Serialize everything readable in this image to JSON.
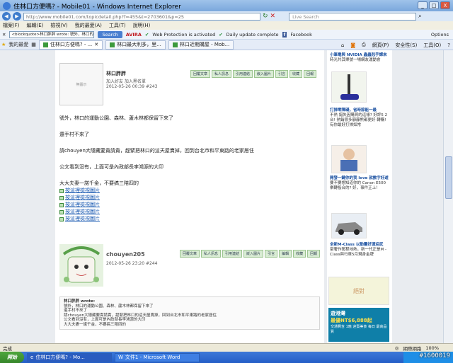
{
  "window": {
    "title": "住林口方便嗎? - Mobile01 - Windows Internet Explorer",
    "min": "_",
    "max": "□",
    "close": "X"
  },
  "address": {
    "url": "http://www.mobile01.com/topicdetail.php?f=455&t=2703601&p=25",
    "live_search": "Live Search"
  },
  "menu": [
    "檔案(F)",
    "編輯(E)",
    "檢視(V)",
    "我的最愛(A)",
    "工具(T)",
    "說明(H)"
  ],
  "toolbar": {
    "search_text": "<blockquote>林口胖胖 wrote: 號外，林口的運動",
    "search_btn": "Search",
    "avira": "AVIRA",
    "web_protection": "Web Protection is activated",
    "daily_update": "Daily update complete",
    "facebook": "Facebook",
    "options": "Options"
  },
  "tabs": {
    "favorites": "我的最愛",
    "items": [
      "住林口方便嗎? - ...",
      "林口最大利多，里...",
      "林口近期購屋 - Mob..."
    ]
  },
  "cmdbar": [
    "網頁(P)",
    "安全性(S)",
    "工具(O)"
  ],
  "post1": {
    "avatar_text": "無圖示",
    "username": "林口胖胖",
    "sub1": "加入好友  加入黑名單",
    "timestamp": "2012-05-26 00:39  #243",
    "actions": [
      "回覆文章",
      "私人訊息",
      "引用連結",
      "嵌入圖片",
      "引言",
      "收藏",
      "回報"
    ],
    "paragraphs": [
      "號外，林口的運動公園、森林、蘆木林都保留下來了",
      "還手村不來了",
      "請chouyen大隱藏要貴請貴，趕緊把林口的這天屋賣掉，回到台北市和平東路的老家居住",
      "公文看到沒有，上面可是內政部長李鴻源的大印",
      "大大夫妻一諾千金，不要搞三陪四的"
    ],
    "links": [
      "按這裡檢視圖片",
      "按這裡檢視圖片",
      "按這裡檢視圖片",
      "按這裡檢視圖片",
      "按這裡檢視圖片"
    ]
  },
  "post2": {
    "username": "chouyen205",
    "timestamp": "2012-05-26 23:20  #244",
    "actions": [
      "回覆文章",
      "私人訊息",
      "引用連結",
      "嵌入圖片",
      "引言",
      "編輯",
      "收藏",
      "回報"
    ],
    "quote": [
      "林口胖胖 wrote:",
      "號外，林口的運動公園、森林、蘆木林都保留下來了",
      "還手村不來了",
      "請chouyen大隱藏要貴請貴，趕緊把林口的這天屋賣掉，回到台北市和平東路的老家居住",
      "公文看到沒有，上面可是內政部長李鴻源的大印",
      "大大夫妻一諾千金，不要搞三陪四的"
    ]
  },
  "sidebar": {
    "ad1_title": "小筆電與 NVIDIA 蟲蟲剋手課來",
    "ad1_desc": "時光共其樂號一場網友運動會",
    "ad2_title": "打掃零障礙，省時節能一最",
    "ad2_desc": "不熱 錯失因購買的這樣? 好評5 2台! 熱銷很多靜靜熊都更好 轉購! 有你最好打掃如常",
    "ad3_title": "開發一鍵你的我 love 就數字好遊",
    "ad3_desc": "要不要想知道你的 Canon E500 樂轉投合的? 好，事件正上！",
    "ad4_title": "全新M-Class 以動靈好運迎武",
    "ad4_desc": "豪奢作駕程地熱，新一代正是M -Class與行車5月現身金牌",
    "ad5_label": "絕對",
    "ad6_title": "遊港灣",
    "ad6_price": "最優NT$6,888起",
    "ad6_desc": "交通費含 1晚 迎賓美食 每日 最高品質"
  },
  "status": {
    "left": "完成",
    "zone": "網際網路",
    "zoom": "100%"
  },
  "taskbar": {
    "start": "開始",
    "tasks": [
      "住林口方便嗎? - Mo...",
      "文件1 - Microsoft Word"
    ]
  },
  "watermark": "#1600019"
}
